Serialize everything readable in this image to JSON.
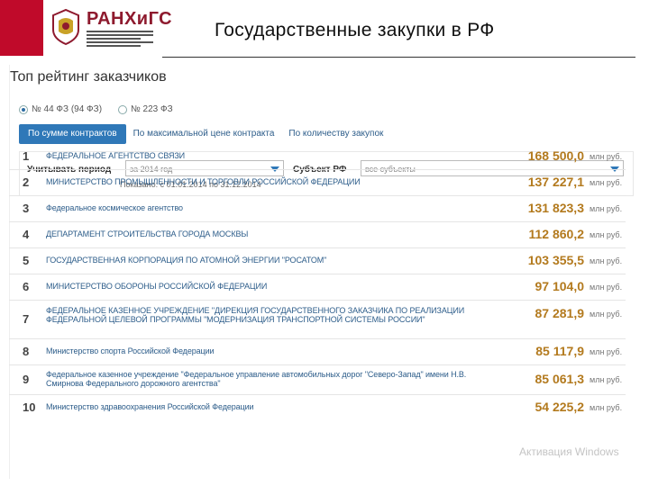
{
  "header": {
    "logo_text": "РАНХиГС",
    "title": "Государственные закупки в РФ"
  },
  "panel": {
    "heading": "Топ рейтинг заказчиков",
    "radios": [
      {
        "label": "№ 44 ФЗ (94 ФЗ)",
        "selected": true
      },
      {
        "label": "№ 223 ФЗ",
        "selected": false
      }
    ],
    "tabs": {
      "active": "По сумме контрактов",
      "second": "По максимальной цене контракта",
      "third": "По количеству закупок"
    },
    "filters": {
      "period_label": "Учитывать период",
      "period_value": "за 2014 год",
      "region_label": "Субъект РФ",
      "region_value": "все субъекты",
      "shown_text": "Показано: с 01.01.2014 по 31.12.2014"
    }
  },
  "rows": [
    {
      "rank": "1",
      "name": "ФЕДЕРАЛЬНОЕ АГЕНТСТВО СВЯЗИ",
      "amount": "168 500,0",
      "unit": "млн руб."
    },
    {
      "rank": "2",
      "name": "МИНИСТЕРСТВО ПРОМЫШЛЕННОСТИ И ТОРГОВЛИ РОССИЙСКОЙ ФЕДЕРАЦИИ",
      "amount": "137 227,1",
      "unit": "млн руб."
    },
    {
      "rank": "3",
      "name": "Федеральное космическое агентство",
      "amount": "131 823,3",
      "unit": "млн руб."
    },
    {
      "rank": "4",
      "name": "ДЕПАРТАМЕНТ СТРОИТЕЛЬСТВА ГОРОДА МОСКВЫ",
      "amount": "112 860,2",
      "unit": "млн руб."
    },
    {
      "rank": "5",
      "name": "ГОСУДАРСТВЕННАЯ КОРПОРАЦИЯ ПО АТОМНОЙ ЭНЕРГИИ \"РОСАТОМ\"",
      "amount": "103 355,5",
      "unit": "млн руб."
    },
    {
      "rank": "6",
      "name": "МИНИСТЕРСТВО ОБОРОНЫ РОССИЙСКОЙ ФЕДЕРАЦИИ",
      "amount": "97 104,0",
      "unit": "млн руб."
    },
    {
      "rank": "7",
      "name": "ФЕДЕРАЛЬНОЕ КАЗЕННОЕ УЧРЕЖДЕНИЕ \"ДИРЕКЦИЯ ГОСУДАРСТВЕННОГО ЗАКАЗЧИКА ПО РЕАЛИЗАЦИИ ФЕДЕРАЛЬНОЙ ЦЕЛЕВОЙ ПРОГРАММЫ \"МОДЕРНИЗАЦИЯ ТРАНСПОРТНОЙ СИСТЕМЫ РОССИИ\"",
      "amount": "87 281,9",
      "unit": "млн руб."
    },
    {
      "rank": "8",
      "name": "Министерство спорта Российской Федерации",
      "amount": "85 117,9",
      "unit": "млн руб."
    },
    {
      "rank": "9",
      "name": "Федеральное казенное учреждение \"Федеральное управление автомобильных дорог \"Северо-Запад\" имени Н.В. Смирнова Федерального дорожного агентства\"",
      "amount": "85 061,3",
      "unit": "млн руб."
    },
    {
      "rank": "10",
      "name": "Министерство здравоохранения Российской Федерации",
      "amount": "54 225,2",
      "unit": "млн руб."
    }
  ],
  "watermark": {
    "line1": "Активация Windows"
  }
}
